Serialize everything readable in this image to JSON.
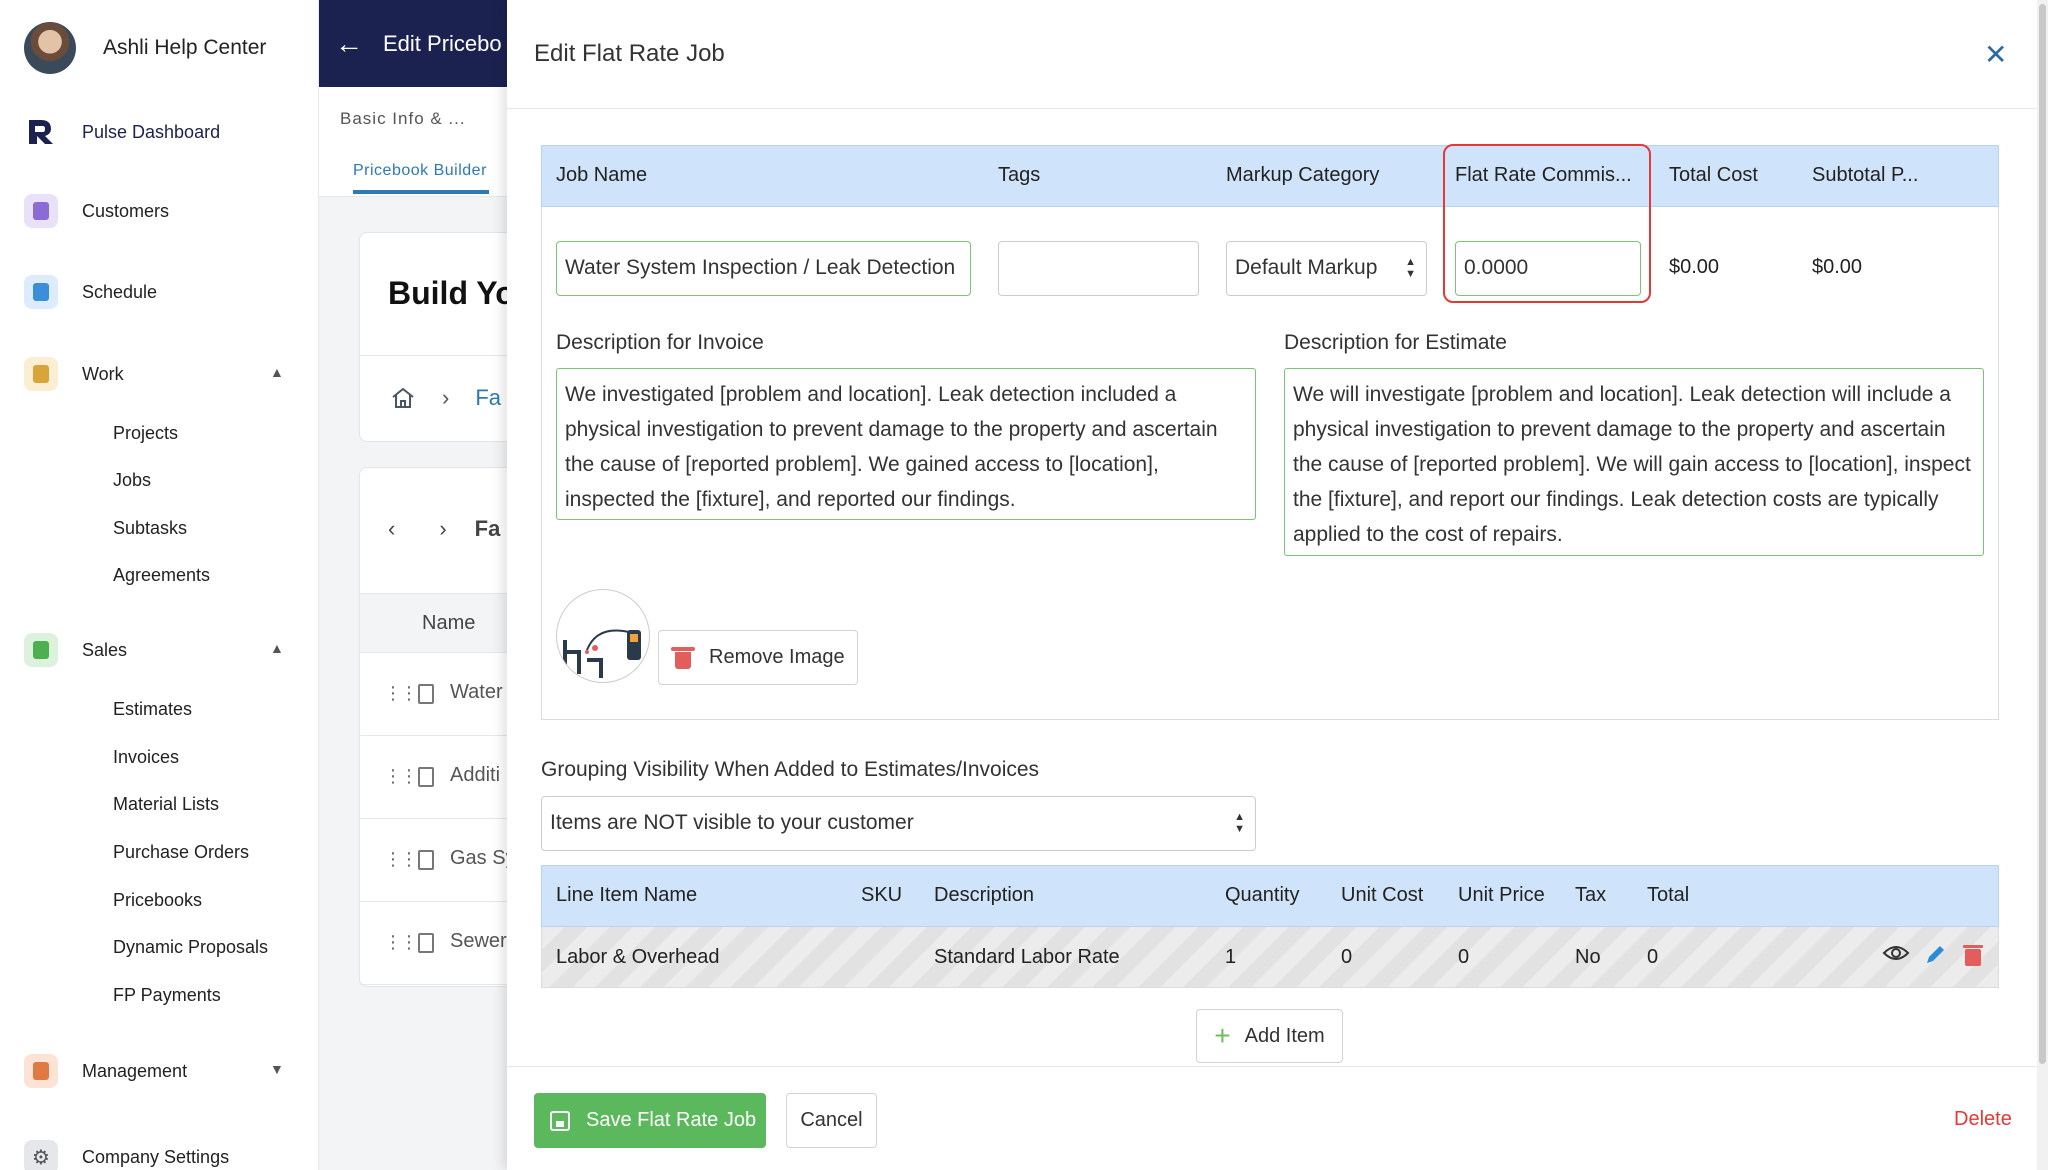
{
  "sidebar": {
    "user_name": "Ashli Help Center",
    "items": {
      "pulse": "Pulse Dashboard",
      "customers": "Customers",
      "schedule": "Schedule",
      "work": "Work",
      "sales": "Sales",
      "management": "Management",
      "company_settings": "Company Settings"
    },
    "work_sub": [
      "Projects",
      "Jobs",
      "Subtasks",
      "Agreements"
    ],
    "sales_sub": [
      "Estimates",
      "Invoices",
      "Material Lists",
      "Purchase Orders",
      "Pricebooks",
      "Dynamic Proposals",
      "FP Payments"
    ]
  },
  "middle": {
    "header_title": "Edit Pricebo",
    "basic_info": "Basic Info & ...",
    "tab_label": "Pricebook Builder",
    "build_title": "Build Yo",
    "crumb_text": "Fa",
    "nav_text": "Fa",
    "name_header": "Name",
    "rows": [
      "Water",
      "Additi",
      "Gas Sy",
      "Sewer"
    ]
  },
  "modal": {
    "title": "Edit Flat Rate Job",
    "close_icon": "close-icon",
    "headers": {
      "job_name": "Job Name",
      "tags": "Tags",
      "markup_category": "Markup Category",
      "flat_rate_commission": "Flat Rate Commis...",
      "total_cost": "Total Cost",
      "subtotal": "Subtotal P..."
    },
    "fields": {
      "job_name_value": "Water System Inspection / Leak Detection",
      "tags_value": "",
      "markup_value": "Default Markup",
      "commission_value": "0.0000",
      "total_cost_value": "$0.00",
      "subtotal_value": "$0.00"
    },
    "desc_invoice_label": "Description for Invoice",
    "desc_invoice": "We investigated [problem and location]. Leak detection included a physical investigation to prevent damage to the property and ascertain the cause of [reported problem]. We gained access to [location], inspected the [fixture], and reported our findings.",
    "desc_estimate_label": "Description for Estimate",
    "desc_estimate": "We will investigate [problem and location]. Leak detection will include a physical investigation to prevent damage to the property and ascertain the cause of [reported problem]. We will gain access to [location], inspect the [fixture], and report our findings. Leak detection costs are typically applied to the cost of repairs.",
    "remove_image": "Remove Image",
    "grouping_label": "Grouping Visibility When Added to Estimates/Invoices",
    "grouping_value": "Items are NOT visible to your customer",
    "line_headers": {
      "name": "Line Item Name",
      "sku": "SKU",
      "description": "Description",
      "quantity": "Quantity",
      "unit_cost": "Unit Cost",
      "unit_price": "Unit Price",
      "tax": "Tax",
      "total": "Total"
    },
    "line_items": [
      {
        "name": "Labor & Overhead",
        "sku": "",
        "description": "Standard Labor Rate",
        "quantity": "1",
        "unit_cost": "0",
        "unit_price": "0",
        "tax": "No",
        "total": "0"
      }
    ],
    "add_item": "Add Item",
    "save": "Save Flat Rate Job",
    "cancel": "Cancel",
    "delete": "Delete"
  },
  "colors": {
    "header_bg": "#cfe4fb",
    "primary_navy": "#1b2250",
    "save_green": "#5cb85c",
    "highlight_red": "#e53935",
    "input_green_border": "#7cc576"
  }
}
